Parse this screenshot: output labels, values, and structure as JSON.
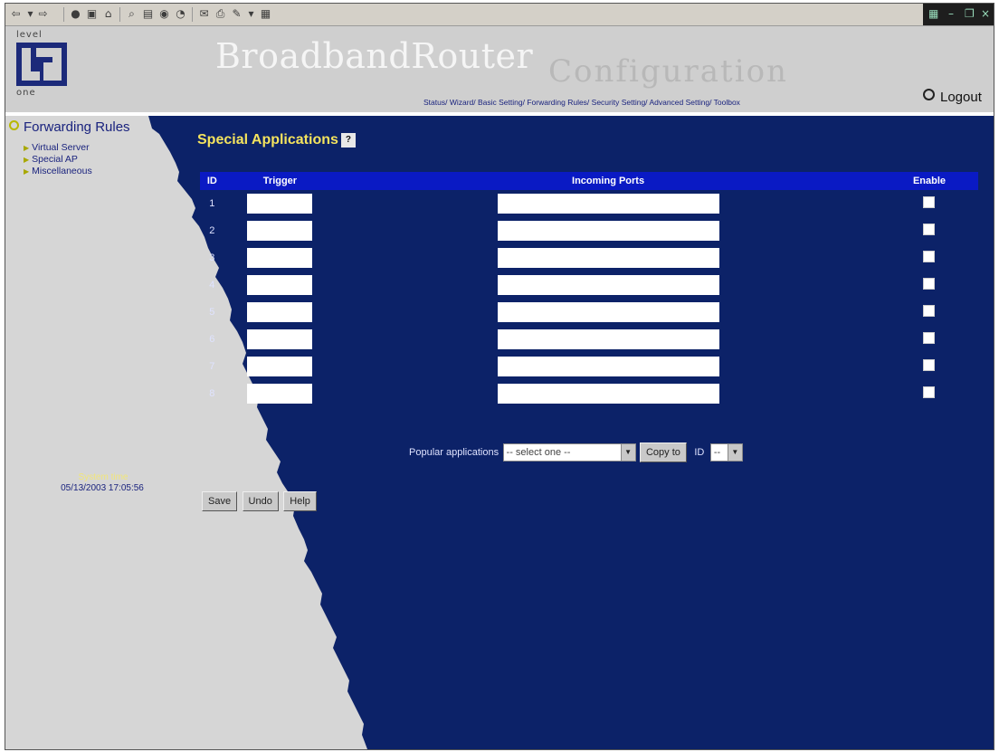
{
  "header": {
    "logo_lines": [
      "level",
      "one"
    ],
    "brand": "BroadbandRouter",
    "brand_sub": "Configuration",
    "nav_links": "Status/ Wizard/ Basic Setting/ Forwarding Rules/ Security Setting/ Advanced Setting/ Toolbox",
    "logout_label": "Logout"
  },
  "sidebar": {
    "title": "Forwarding Rules",
    "items": [
      {
        "label": "Virtual Server"
      },
      {
        "label": "Special AP"
      },
      {
        "label": "Miscellaneous"
      }
    ],
    "time_label": "System time",
    "time_value": "05/13/2003 17:05:56"
  },
  "main": {
    "heading": "Special Applications",
    "help_chip": "?",
    "table": {
      "columns": [
        "ID",
        "Trigger",
        "Incoming Ports",
        "Enable"
      ],
      "rows": [
        {
          "id": "1",
          "trigger": "",
          "ports": "",
          "enabled": false
        },
        {
          "id": "2",
          "trigger": "",
          "ports": "",
          "enabled": false
        },
        {
          "id": "3",
          "trigger": "",
          "ports": "",
          "enabled": false
        },
        {
          "id": "4",
          "trigger": "",
          "ports": "",
          "enabled": false
        },
        {
          "id": "5",
          "trigger": "",
          "ports": "",
          "enabled": false
        },
        {
          "id": "6",
          "trigger": "",
          "ports": "",
          "enabled": false
        },
        {
          "id": "7",
          "trigger": "",
          "ports": "",
          "enabled": false
        },
        {
          "id": "8",
          "trigger": "",
          "ports": "",
          "enabled": false
        }
      ]
    },
    "popular": {
      "label": "Popular applications",
      "select_value": "-- select one --",
      "copy_button": "Copy to",
      "id_label": "ID",
      "id_select_value": "--"
    },
    "buttons": {
      "save": "Save",
      "undo": "Undo",
      "help": "Help"
    }
  },
  "colors": {
    "content_bg": "#0c2268",
    "header_bg": "#cfcfcf",
    "heading_yellow": "#f4e35e",
    "table_header_blue": "#0a1ac4"
  }
}
